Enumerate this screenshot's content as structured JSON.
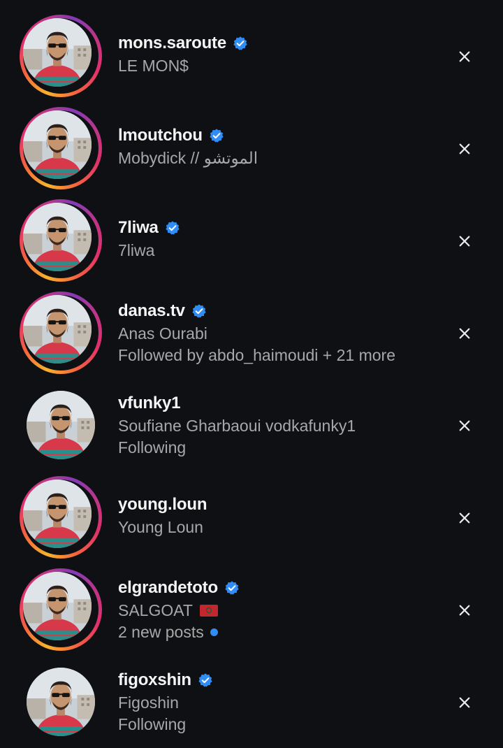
{
  "colors": {
    "background": "#0e1013",
    "username": "#f5f5f5",
    "secondary": "#a8a8a8",
    "verified_badge": "#2f8df5",
    "story_ring": [
      "#f7b32b",
      "#e1306c",
      "#833ab4"
    ]
  },
  "icons": {
    "verified": "verified-badge-icon",
    "dismiss": "close-icon",
    "unread": "blue-dot-icon",
    "flag": "morocco-flag-icon"
  },
  "accounts": [
    {
      "username": "mons.saroute",
      "verified": true,
      "story_ring": true,
      "lines": [
        "LE MON$"
      ]
    },
    {
      "username": "lmoutchou",
      "verified": true,
      "story_ring": true,
      "lines": [
        "Mobydick // الموتشو"
      ]
    },
    {
      "username": "7liwa",
      "verified": true,
      "story_ring": true,
      "lines": [
        "7liwa"
      ]
    },
    {
      "username": "danas.tv",
      "verified": true,
      "story_ring": true,
      "lines": [
        "Anas Ourabi",
        "Followed by abdo_haimoudi + 21 more"
      ]
    },
    {
      "username": "vfunky1",
      "verified": false,
      "story_ring": false,
      "lines": [
        "Soufiane Gharbaoui vodkafunky1",
        "Following"
      ]
    },
    {
      "username": "young.loun",
      "verified": false,
      "story_ring": true,
      "lines": [
        "Young Loun"
      ]
    },
    {
      "username": "elgrandetoto",
      "verified": true,
      "story_ring": true,
      "lines": [
        "SALGOAT",
        "2 new posts"
      ]
    },
    {
      "username": "figoxshin",
      "verified": true,
      "story_ring": false,
      "lines": [
        "Figoshin",
        "Following"
      ]
    }
  ]
}
